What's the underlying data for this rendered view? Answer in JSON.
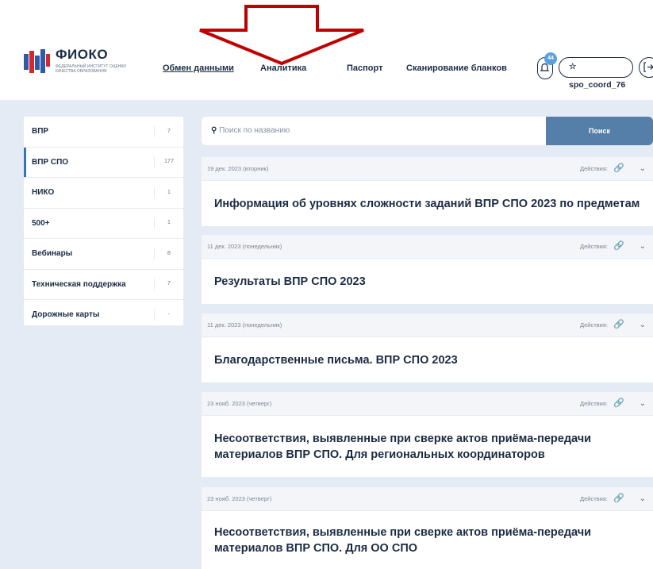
{
  "header": {
    "logo_name": "ФИОКО",
    "logo_subtitle": "ФЕДЕРАЛЬНЫЙ ИНСТИТУТ ОЦЕНКИ КАЧЕСТВА ОБРАЗОВАНИЯ",
    "nav": [
      "Обмен данными",
      "Аналитика",
      "Паспорт",
      "Сканирование бланков"
    ],
    "notifications_count": "44",
    "username": "spo_coord_76"
  },
  "sidebar": {
    "items": [
      {
        "label": "ВПР",
        "count": "7"
      },
      {
        "label": "ВПР СПО",
        "count": "177"
      },
      {
        "label": "НИКО",
        "count": "1"
      },
      {
        "label": "500+",
        "count": "1"
      },
      {
        "label": "Вебинары",
        "count": "8"
      },
      {
        "label": "Техническая поддержка",
        "count": "7"
      },
      {
        "label": "Дорожные карты",
        "count": "-"
      }
    ]
  },
  "search": {
    "placeholder": "Поиск по названию",
    "button_label": "Поиск"
  },
  "actions_label": "Действия:",
  "cards": [
    {
      "date": "19 дек. 2023 (вторник)",
      "title": "Информация об уровнях сложности заданий ВПР СПО 2023 по предметам"
    },
    {
      "date": "11 дек. 2023 (понедельник)",
      "title": "Результаты ВПР СПО 2023"
    },
    {
      "date": "11 дек. 2023 (понедельник)",
      "title": "Благодарственные письма. ВПР СПО 2023"
    },
    {
      "date": "23 нояб. 2023 (четверг)",
      "title": "Несоответствия, выявленные при сверке актов приёма-передачи материалов ВПР СПО. Для региональных координаторов"
    },
    {
      "date": "23 нояб. 2023 (четверг)",
      "title": "Несоответствия, выявленные при сверке актов приёма-передачи материалов ВПР СПО. Для ОО СПО"
    }
  ],
  "colors": {
    "accent": "#557fa8",
    "arrow": "#c00000",
    "background": "#e5ebf4"
  }
}
